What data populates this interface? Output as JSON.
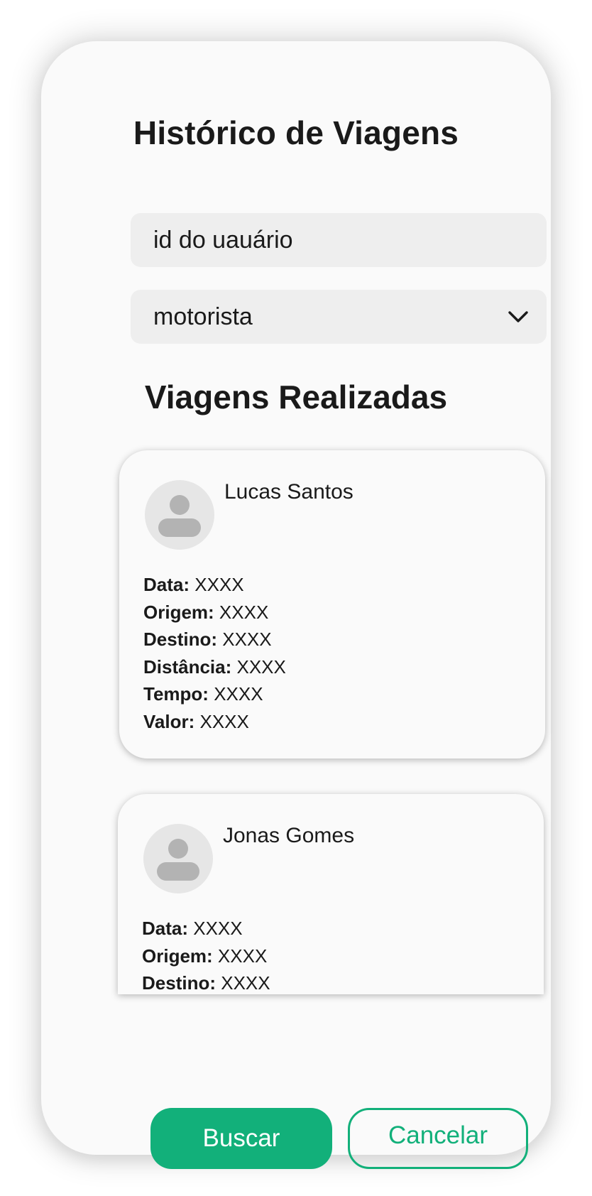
{
  "header": {
    "title": "Histórico de Viagens"
  },
  "form": {
    "user_id_value": "id do uauário",
    "role_select_value": "motorista"
  },
  "section": {
    "title": "Viagens Realizadas"
  },
  "trips": [
    {
      "name": "Lucas Santos",
      "fields": [
        {
          "label": "Data:",
          "value": "XXXX"
        },
        {
          "label": "Origem:",
          "value": "XXXX"
        },
        {
          "label": "Destino:",
          "value": "XXXX"
        },
        {
          "label": "Distância:",
          "value": "XXXX"
        },
        {
          "label": "Tempo:",
          "value": "XXXX"
        },
        {
          "label": "Valor:",
          "value": "XXXX"
        }
      ]
    },
    {
      "name": "Jonas Gomes",
      "fields": [
        {
          "label": "Data:",
          "value": "XXXX"
        },
        {
          "label": "Origem:",
          "value": "XXXX"
        },
        {
          "label": "Destino:",
          "value": "XXXX"
        }
      ]
    }
  ],
  "actions": {
    "search_label": "Buscar",
    "cancel_label": "Cancelar"
  },
  "colors": {
    "accent": "#12b07a",
    "field_bg": "#eeeeee",
    "avatar_bg": "#e6e6e6",
    "avatar_icon": "#b3b3b3"
  },
  "icons": {
    "select": "chevron-down-icon",
    "avatar": "user-silhouette-icon"
  }
}
